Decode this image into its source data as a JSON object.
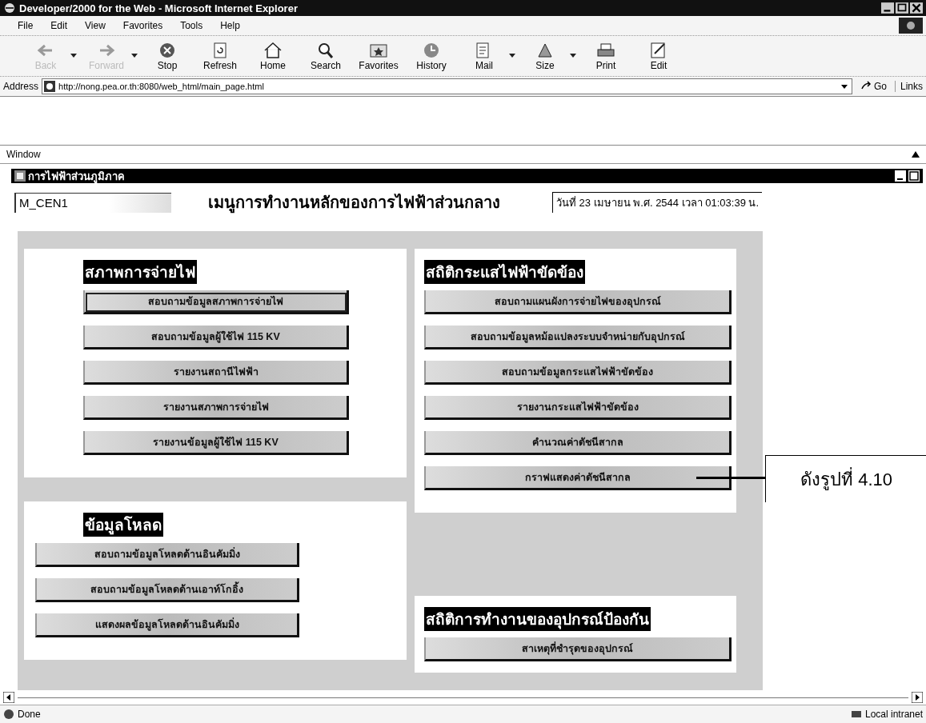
{
  "window": {
    "title": "Developer/2000 for the Web - Microsoft Internet Explorer"
  },
  "menu": [
    "File",
    "Edit",
    "View",
    "Favorites",
    "Tools",
    "Help"
  ],
  "toolbar": [
    {
      "kind": "back",
      "label": "Back",
      "disabled": true,
      "has_menu": true
    },
    {
      "kind": "forward",
      "label": "Forward",
      "disabled": true,
      "has_menu": true
    },
    {
      "kind": "stop",
      "label": "Stop",
      "disabled": false,
      "has_menu": false
    },
    {
      "kind": "refresh",
      "label": "Refresh",
      "disabled": false,
      "has_menu": false
    },
    {
      "kind": "home",
      "label": "Home",
      "disabled": false,
      "has_menu": false
    },
    {
      "kind": "search",
      "label": "Search",
      "disabled": false,
      "has_menu": false
    },
    {
      "kind": "favorites",
      "label": "Favorites",
      "disabled": false,
      "has_menu": false
    },
    {
      "kind": "history",
      "label": "History",
      "disabled": false,
      "has_menu": false
    },
    {
      "kind": "mail",
      "label": "Mail",
      "disabled": false,
      "has_menu": true
    },
    {
      "kind": "size",
      "label": "Size",
      "disabled": false,
      "has_menu": true
    },
    {
      "kind": "print",
      "label": "Print",
      "disabled": false,
      "has_menu": false
    },
    {
      "kind": "edit",
      "label": "Edit",
      "disabled": false,
      "has_menu": false
    }
  ],
  "address": {
    "label": "Address",
    "url": "http://nong.pea.or.th:8080/web_html/main_page.html",
    "go": "Go",
    "links": "Links"
  },
  "applet_menu": [
    "Window"
  ],
  "form": {
    "title": "การไฟฟ้าส่วนภูมิภาค",
    "field": "M_CEN1",
    "heading": "เมนูการทำงานหลักของการไฟฟ้าส่วนกลาง",
    "datetime": "วันที่ 23 เมษายน  พ.ศ. 2544 เวลา 01:03:39 น."
  },
  "columns": [
    {
      "sections": [
        {
          "title": "สภาพการจ่ายไฟ",
          "buttons": [
            {
              "label": "สอบถามข้อมูลสภาพการจ่ายไฟ",
              "focused": true
            },
            {
              "label": "สอบถามข้อมูลผู้ใช้ไฟ 115 KV",
              "focused": false
            },
            {
              "label": "รายงานสถานีไฟฟ้า",
              "focused": false
            },
            {
              "label": "รายงานสภาพการจ่ายไฟ",
              "focused": false
            },
            {
              "label": "รายงานข้อมูลผู้ใช้ไฟ 115 KV",
              "focused": false
            }
          ]
        },
        {
          "title": "ข้อมูลโหลด",
          "buttons": [
            {
              "label": "สอบถามข้อมูลโหลดด้านอินคัมมิ่ง",
              "focused": false
            },
            {
              "label": "สอบถามข้อมูลโหลดด้านเอาท์โกอิ้ง",
              "focused": false
            },
            {
              "label": "แสดงผลข้อมูลโหลดด้านอินคัมมิ่ง",
              "focused": false
            }
          ]
        }
      ]
    },
    {
      "sections": [
        {
          "title": "สถิติกระแสไฟฟ้าขัดข้อง",
          "buttons": [
            {
              "label": "สอบถามแผนผังการจ่ายไฟของอุปกรณ์",
              "focused": false
            },
            {
              "label": "สอบถามข้อมูลหม้อแปลงระบบจำหน่ายกับอุปกรณ์",
              "focused": false
            },
            {
              "label": "สอบถามข้อมูลกระแสไฟฟ้าขัดข้อง",
              "focused": false
            },
            {
              "label": "รายงานกระแสไฟฟ้าขัดข้อง",
              "focused": false
            },
            {
              "label": "คำนวณค่าดัชนีสากล",
              "focused": false
            },
            {
              "label": "กราฟแสดงค่าดัชนีสากล",
              "focused": false
            }
          ]
        },
        {
          "title": "สถิติการทำงานของอุปกรณ์ป้องกัน",
          "buttons": [
            {
              "label": "สาเหตุที่ชำรุดของอุปกรณ์",
              "focused": false
            }
          ]
        }
      ]
    }
  ],
  "callout": {
    "text": "ดังรูปที่ 4.10"
  },
  "status_bar": {
    "text": "Done",
    "zone": "Local intranet"
  }
}
